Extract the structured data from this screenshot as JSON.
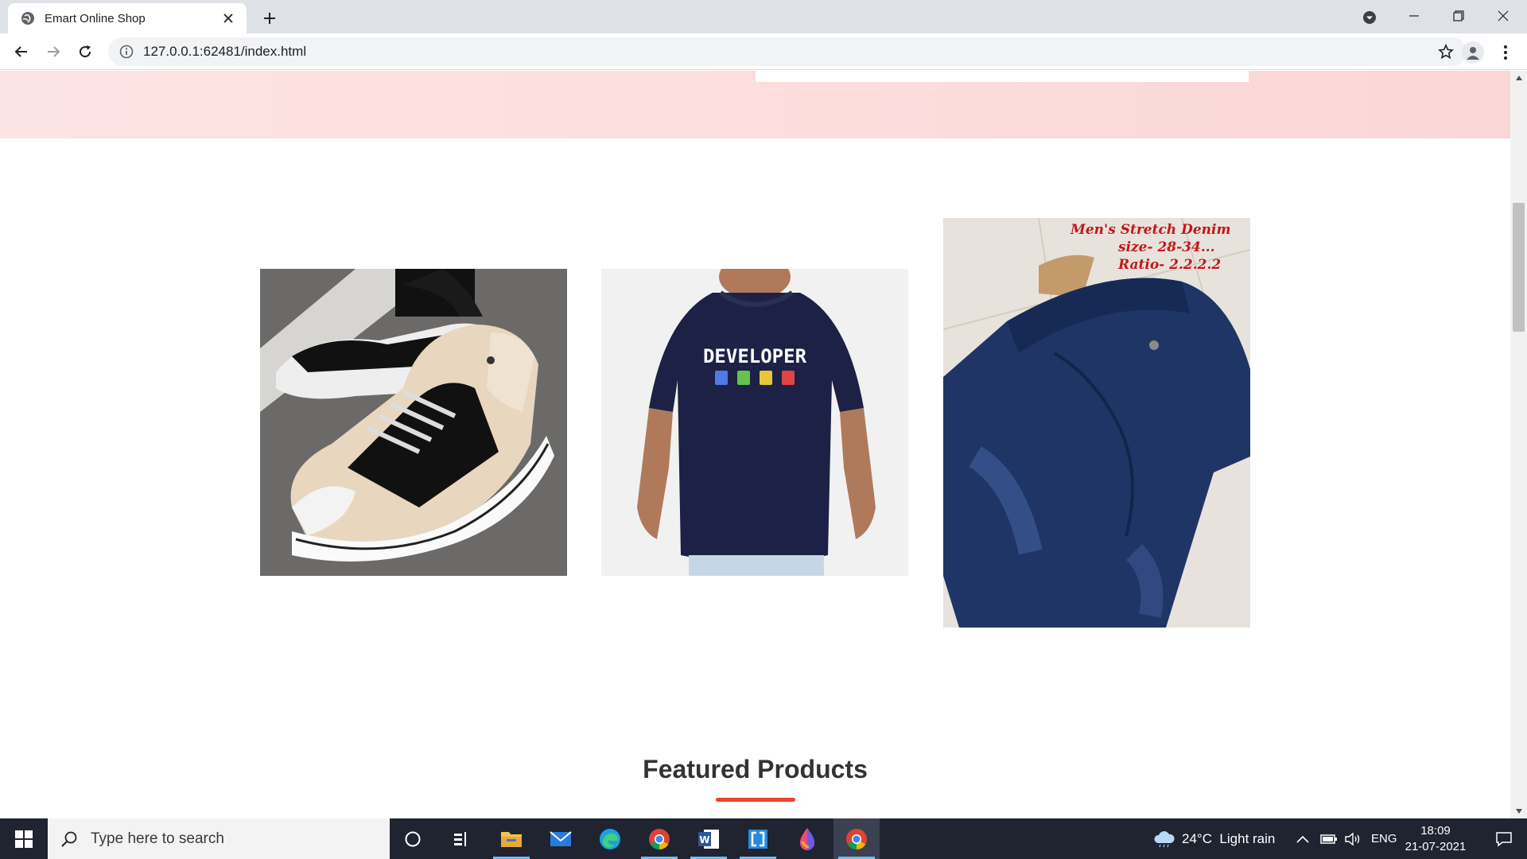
{
  "browser": {
    "tab_title": "Emart Online Shop",
    "url": "127.0.0.1:62481/index.html"
  },
  "page": {
    "banners": [
      {
        "name": "sneakers-banner",
        "alt": "shoe"
      },
      {
        "name": "tshirt-banner",
        "alt": "t-shirt",
        "print_text": "DEVELOPER"
      },
      {
        "name": "jeans-banner",
        "alt": "jeans",
        "caption_lines": [
          "Men's Stretch Denim",
          "size- 28-34...",
          "Ratio- 2.2.2.2"
        ]
      }
    ],
    "section_title": "Featured Products",
    "accent_color": "#ea4335"
  },
  "taskbar": {
    "search_placeholder": "Type here to search",
    "weather": "24°C  Light rain",
    "language": "ENG",
    "time": "18:09",
    "date": "21-07-2021",
    "apps": [
      "cortana-icon",
      "task-view-icon",
      "file-explorer-icon",
      "mail-icon",
      "edge-icon",
      "chrome-icon",
      "word-icon",
      "app-icon",
      "paint-icon",
      "chrome-active-icon"
    ]
  }
}
